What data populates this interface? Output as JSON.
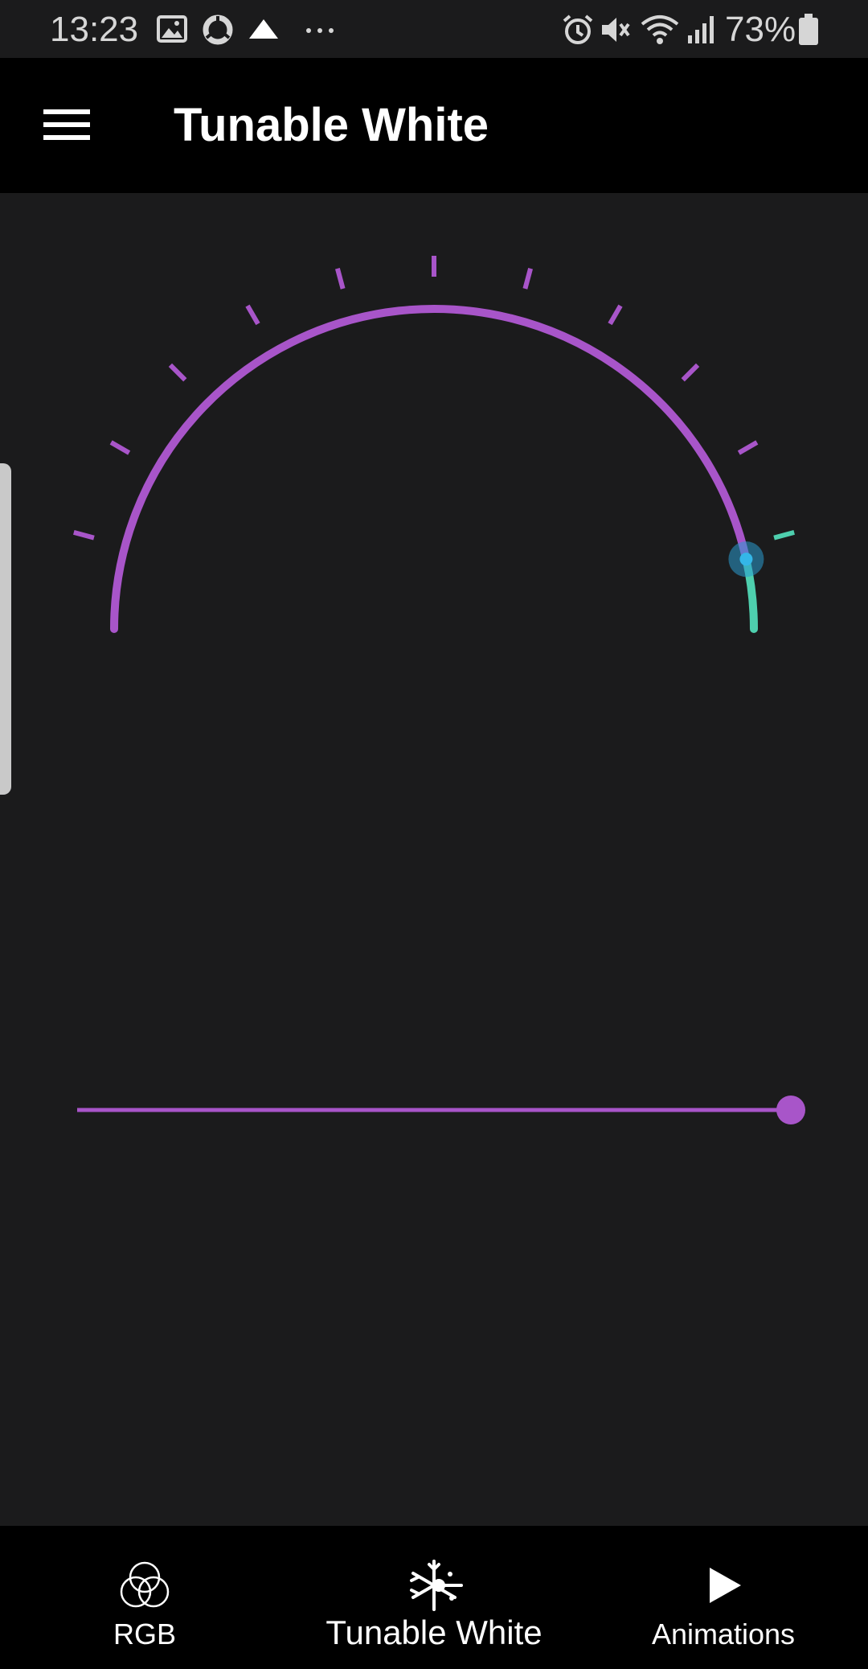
{
  "status_bar": {
    "time": "13:23",
    "battery": "73%",
    "left_icons": [
      "gallery-icon",
      "sync-icon",
      "drive-icon",
      "more-dots-icon"
    ],
    "right_icons": [
      "alarm-icon",
      "mute-icon",
      "wifi-icon",
      "signal-icon",
      "battery-icon"
    ]
  },
  "app_bar": {
    "title": "Tunable White",
    "menu_icon": "hamburger-menu-icon"
  },
  "dial": {
    "tick_count": 11,
    "active_fraction": 0.93,
    "colors": {
      "track": "#a855c9",
      "active": "#4ecfae",
      "thumb": "#2a9bd0"
    }
  },
  "brightness_slider": {
    "value_fraction": 1.0,
    "color": "#a855c9"
  },
  "bottom_nav": {
    "items": [
      {
        "label": "RGB",
        "icon": "rgb-circles-icon",
        "active": false
      },
      {
        "label": "Tunable White",
        "icon": "snowflake-sun-icon",
        "active": true
      },
      {
        "label": "Animations",
        "icon": "play-icon",
        "active": false
      }
    ]
  }
}
